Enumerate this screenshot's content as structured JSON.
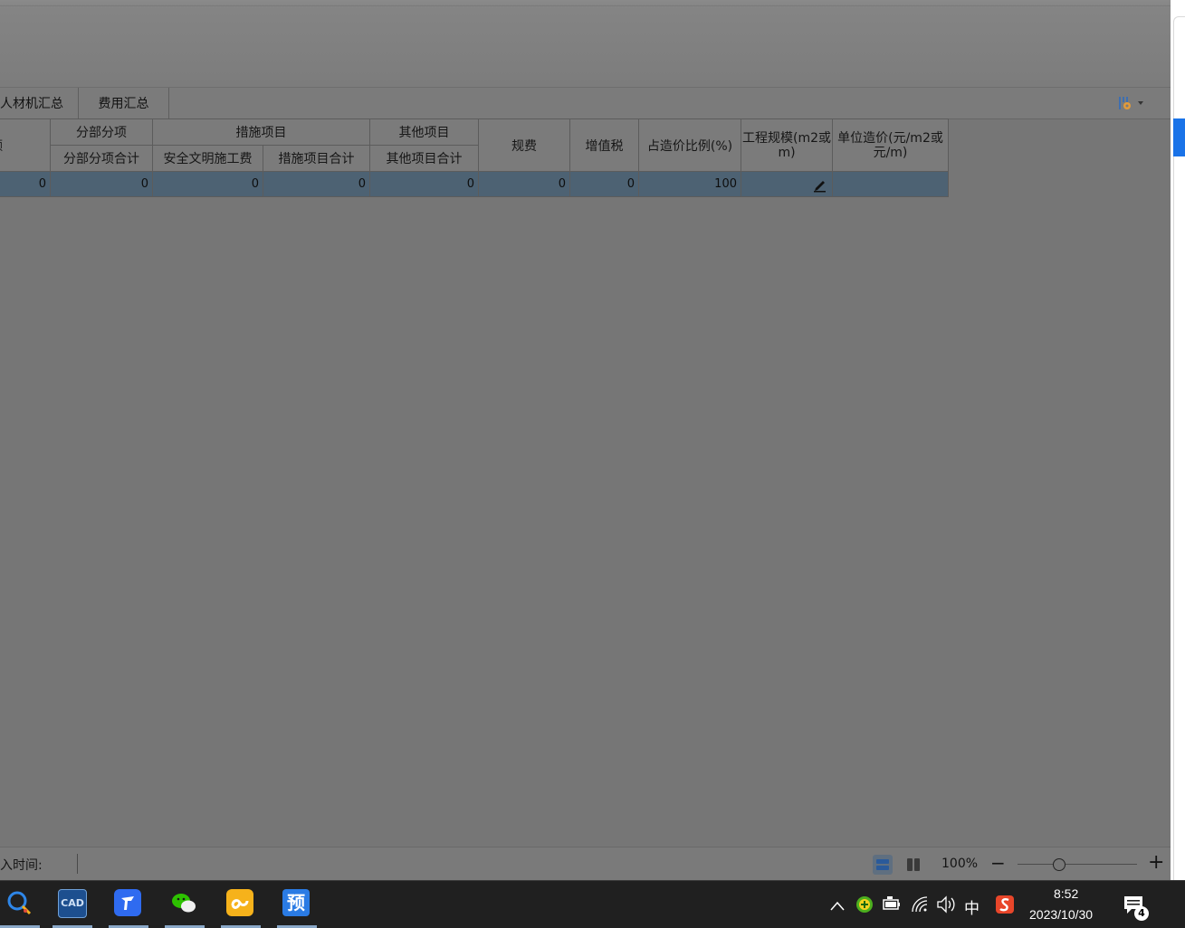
{
  "tabs": [
    {
      "label": "人材机汇总"
    },
    {
      "label": "费用汇总"
    }
  ],
  "grid": {
    "header_row1": {
      "col0": "额",
      "group_fenbu": "分部分项",
      "group_cuoshi": "措施项目",
      "group_qita": "其他项目",
      "guifei": "规费",
      "zengzhishui": "增值税",
      "zhanbi": "占造价比例(%)",
      "gongchengguimo": "工程规模(m2或m)",
      "danweizaojia": "单位造价(元/m2或元/m)"
    },
    "header_row2": {
      "fenbu_total": "分部分项合计",
      "anquan": "安全文明施工费",
      "cuoshi_total": "措施项目合计",
      "qita_total": "其他项目合计"
    },
    "row": [
      "0",
      "0",
      "0",
      "0",
      "0",
      "0",
      "0",
      "100",
      "",
      ""
    ]
  },
  "statusbar": {
    "time_label": "入时间:",
    "zoom": "100%",
    "zoom_minus": "−",
    "zoom_plus": "+"
  },
  "taskbar": {
    "apps": [
      "search-app",
      "cad-app",
      "feishu-app",
      "wechat-app",
      "baidu-netdisk-app",
      "yusuan-app"
    ],
    "yusuan_label": "预",
    "cad_label": "CAD",
    "ime": "中",
    "time": "8:52",
    "date": "2023/10/30",
    "notifications": "4"
  },
  "colors": {
    "accent": "#1a73e8",
    "row_selected": "#4d6273",
    "taskbar": "#202020"
  }
}
